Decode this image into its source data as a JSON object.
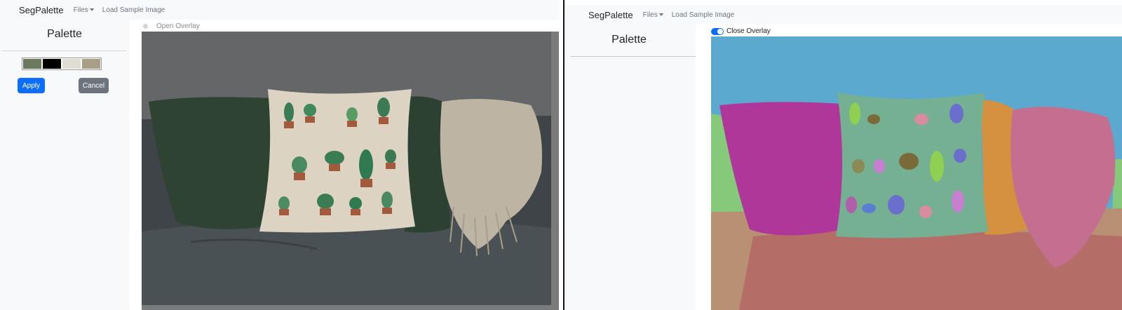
{
  "left": {
    "navbar": {
      "brand": "SegPalette",
      "files_label": "Files",
      "load_sample_label": "Load Sample Image"
    },
    "sidebar": {
      "title": "Palette",
      "swatches": [
        "#6b7a5c",
        "#000000",
        "#e0ddd3",
        "#a89f86"
      ],
      "apply_label": "Apply",
      "cancel_label": "Cancel"
    },
    "overlay_toggle": {
      "label": "Open Overlay",
      "checked": false
    }
  },
  "right": {
    "navbar": {
      "brand": "SegPalette",
      "files_label": "Files",
      "load_sample_label": "Load Sample Image"
    },
    "sidebar": {
      "title": "Palette"
    },
    "overlay_toggle": {
      "label": "Close Overlay",
      "checked": true
    }
  },
  "colors": {
    "primary": "#0d6efd",
    "secondary": "#6c757d",
    "navbar_bg": "#f8f9fa",
    "segment_sky": "#5ba9cf",
    "segment_left_pillow": "#b0379a",
    "segment_middle_pillow": "#76b093",
    "segment_back_pillow": "#d4913f",
    "segment_throw": "#c56f90",
    "segment_sofa": "#b56d67"
  }
}
